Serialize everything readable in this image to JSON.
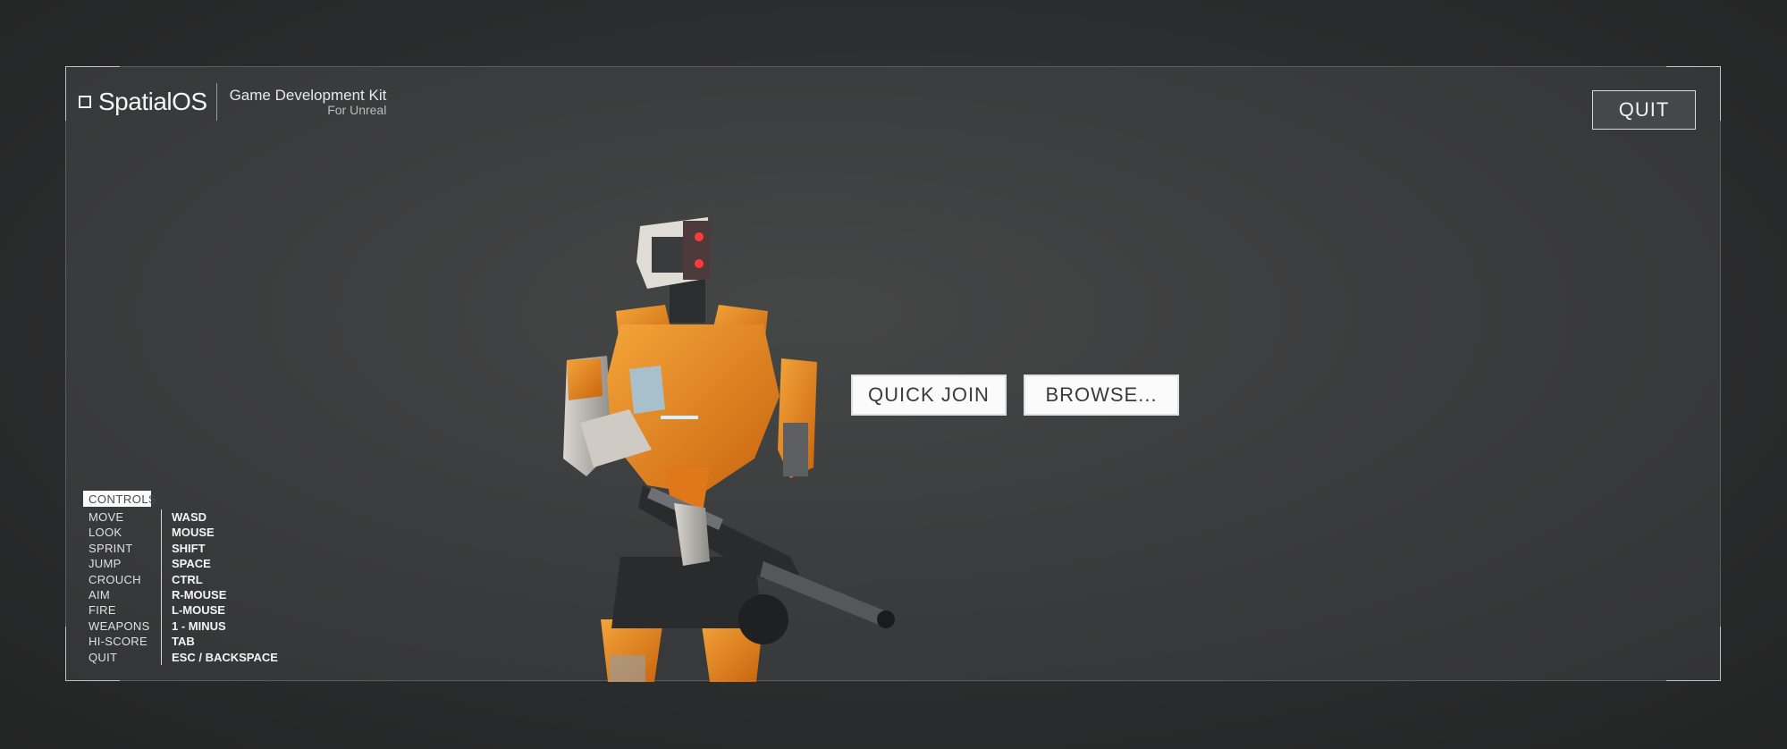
{
  "logo": {
    "name": "SpatialOS",
    "kit_title": "Game Development Kit",
    "kit_subtitle": "For Unreal"
  },
  "menu": {
    "quit_label": "QUIT",
    "quick_join_label": "QUICK JOIN",
    "browse_label": "BROWSE..."
  },
  "controls": {
    "title": "CONTROLS",
    "bindings": [
      {
        "action": "MOVE",
        "key": "WASD"
      },
      {
        "action": "LOOK",
        "key": "MOUSE"
      },
      {
        "action": "SPRINT",
        "key": "SHIFT"
      },
      {
        "action": "JUMP",
        "key": "SPACE"
      },
      {
        "action": "CROUCH",
        "key": "CTRL"
      },
      {
        "action": "AIM",
        "key": "R-MOUSE"
      },
      {
        "action": "FIRE",
        "key": "L-MOUSE"
      },
      {
        "action": "WEAPONS",
        "key": "1 - MINUS"
      },
      {
        "action": "HI-SCORE",
        "key": "TAB"
      },
      {
        "action": "QUIT",
        "key": "ESC / BACKSPACE"
      }
    ]
  },
  "colors": {
    "robot_orange": "#e88a1e",
    "button_bg": "#fbfbfb",
    "panel_bg": "#3d3e3f"
  },
  "icons": {
    "logo_mark": "square-outline-icon",
    "character": "robot-soldier-image"
  }
}
